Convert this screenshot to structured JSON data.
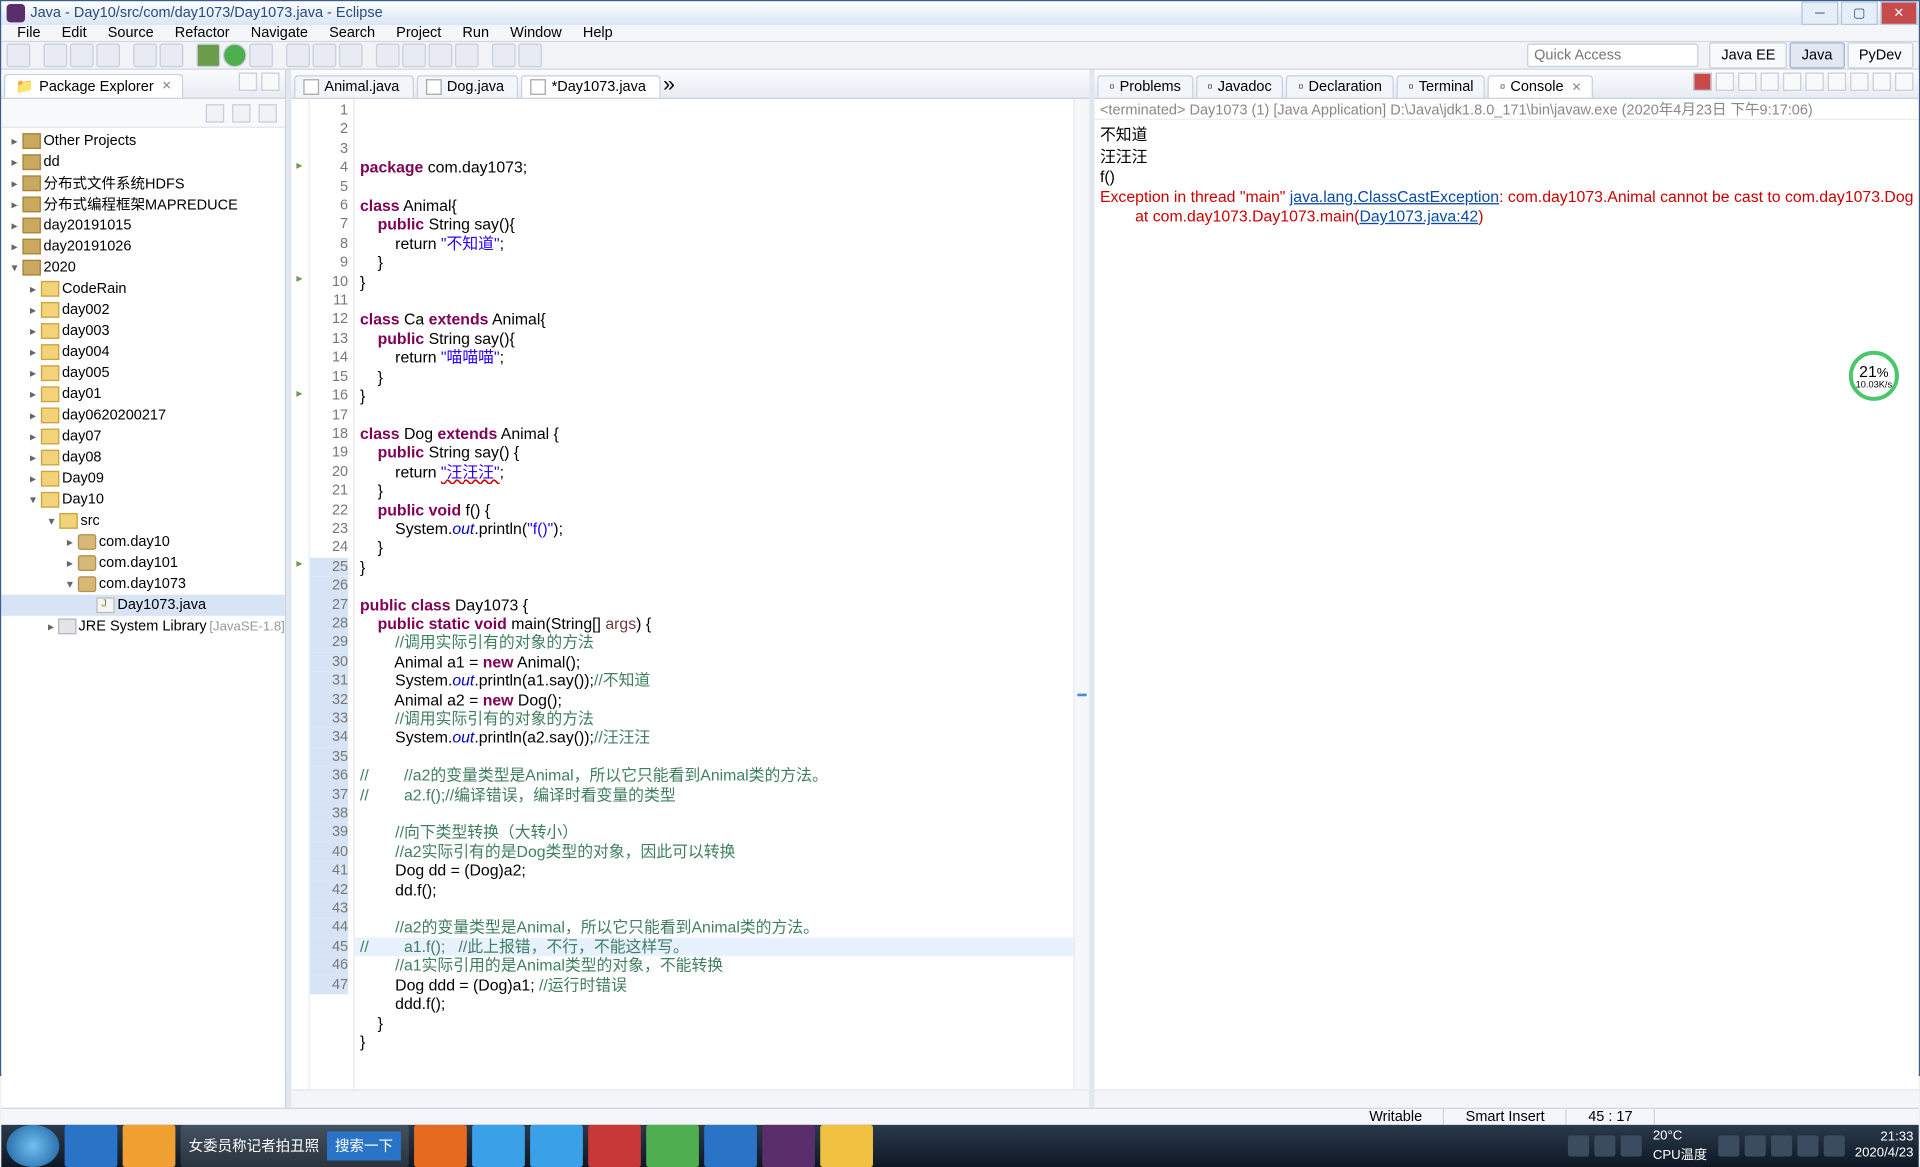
{
  "title": "Java - Day10/src/com/day1073/Day1073.java - Eclipse",
  "menus": [
    "File",
    "Edit",
    "Source",
    "Refactor",
    "Navigate",
    "Search",
    "Project",
    "Run",
    "Window",
    "Help"
  ],
  "quick_access": "Quick Access",
  "perspectives": [
    {
      "label": "Java EE"
    },
    {
      "label": "Java",
      "active": true
    },
    {
      "label": "PyDev"
    }
  ],
  "package_explorer": {
    "title": "Package Explorer",
    "items": [
      {
        "i": 0,
        "tw": "▸",
        "k": "proj",
        "label": "Other Projects"
      },
      {
        "i": 0,
        "tw": "▸",
        "k": "proj",
        "label": "dd"
      },
      {
        "i": 0,
        "tw": "▸",
        "k": "proj",
        "label": "分布式文件系统HDFS"
      },
      {
        "i": 0,
        "tw": "▸",
        "k": "proj",
        "label": "分布式编程框架MAPREDUCE"
      },
      {
        "i": 0,
        "tw": "▸",
        "k": "proj",
        "label": "day20191015"
      },
      {
        "i": 0,
        "tw": "▸",
        "k": "proj",
        "label": "day20191026"
      },
      {
        "i": 0,
        "tw": "▾",
        "k": "proj",
        "label": "2020"
      },
      {
        "i": 1,
        "tw": "▸",
        "k": "fold",
        "label": "CodeRain"
      },
      {
        "i": 1,
        "tw": "▸",
        "k": "fold",
        "label": "day002"
      },
      {
        "i": 1,
        "tw": "▸",
        "k": "fold",
        "label": "day003"
      },
      {
        "i": 1,
        "tw": "▸",
        "k": "fold",
        "label": "day004"
      },
      {
        "i": 1,
        "tw": "▸",
        "k": "fold",
        "label": "day005"
      },
      {
        "i": 1,
        "tw": "▸",
        "k": "fold",
        "label": "day01"
      },
      {
        "i": 1,
        "tw": "▸",
        "k": "fold",
        "label": "day0620200217"
      },
      {
        "i": 1,
        "tw": "▸",
        "k": "fold",
        "label": "day07"
      },
      {
        "i": 1,
        "tw": "▸",
        "k": "fold",
        "label": "day08"
      },
      {
        "i": 1,
        "tw": "▸",
        "k": "fold",
        "label": "Day09"
      },
      {
        "i": 1,
        "tw": "▾",
        "k": "fold",
        "label": "Day10"
      },
      {
        "i": 2,
        "tw": "▾",
        "k": "fold",
        "label": "src"
      },
      {
        "i": 3,
        "tw": "▸",
        "k": "pkg",
        "label": "com.day10"
      },
      {
        "i": 3,
        "tw": "▸",
        "k": "pkg",
        "label": "com.day101"
      },
      {
        "i": 3,
        "tw": "▾",
        "k": "pkg",
        "label": "com.day1073"
      },
      {
        "i": 4,
        "tw": " ",
        "k": "jfile",
        "label": "Day1073.java",
        "sel": true
      },
      {
        "i": 2,
        "tw": "▸",
        "k": "lib",
        "label": "JRE System Library",
        "ver": "[JavaSE-1.8]"
      }
    ]
  },
  "editor_tabs": [
    {
      "label": "Animal.java"
    },
    {
      "label": "Dog.java"
    },
    {
      "label": "*Day1073.java",
      "active": true
    }
  ],
  "bottom_tabs": [
    {
      "label": "Problems"
    },
    {
      "label": "Javadoc"
    },
    {
      "label": "Declaration"
    },
    {
      "label": "Terminal"
    },
    {
      "label": "Console",
      "active": true
    }
  ],
  "console_info": "<terminated> Day1073 (1) [Java Application] D:\\Java\\jdk1.8.0_171\\bin\\javaw.exe (2020年4月23日 下午9:17:06)",
  "console_lines": {
    "l1": "不知道",
    "l2": "汪汪汪",
    "l3": "f()",
    "err1_a": "Exception in thread \"main\" ",
    "err1_b": "java.lang.ClassCastException",
    "err1_c": ": com.day1073.Animal cannot be cast to com.day1073.Dog",
    "err2_a": "        at com.day1073.Day1073.main(",
    "err2_b": "Day1073.java:42",
    "err2_c": ")"
  },
  "status": {
    "writable": "Writable",
    "insert": "Smart Insert",
    "pos": "45 : 17"
  },
  "taskbar": {
    "search_label": "女委员称记者拍丑照",
    "search_btn": "搜索一下",
    "temp": "20°C",
    "cpu": "CPU温度",
    "time": "21:33",
    "date": "2020/4/23"
  },
  "speed": {
    "val": "21",
    "unit": "%",
    "rate": "10.03K/s"
  },
  "code": {
    "lines": 47,
    "current": 45,
    "sel_start": 25,
    "sel_end": 47,
    "t01a": "package",
    "t01b": " com.day1073;",
    "t03a": "class",
    "t03b": " Animal{",
    "t04a": "    public",
    "t04b": " String say(){",
    "t05a": "        return ",
    "t05b": "\"不知道\"",
    "t05c": ";",
    "t06": "    }",
    "t07": "}",
    "t09a": "class",
    "t09b": " Ca ",
    "t09c": "extends",
    "t09d": " Animal{",
    "t10a": "    public",
    "t10b": " String say(){",
    "t11a": "        return ",
    "t11b": "\"喵喵喵\"",
    "t11c": ";",
    "t12": "    }",
    "t13": "}",
    "t15a": "class",
    "t15b": " Dog ",
    "t15c": "extends",
    "t15d": " Animal {",
    "t16a": "    public",
    "t16b": " String say() {",
    "t17a": "        return ",
    "t17b": "\"汪汪汪\"",
    "t17c": ";",
    "t18": "    }",
    "t19a": "    public void",
    "t19b": " f() {",
    "t20a": "        System.",
    "t20b": "out",
    "t20c": ".println(",
    "t20d": "\"f()\"",
    "t20e": ");",
    "t21": "    }",
    "t22": "}",
    "t24a": "public class",
    "t24b": " Day1073 {",
    "t25a": "    public static void",
    "t25b": " main(String[] ",
    "t25c": "args",
    "t25d": ") {",
    "t26": "        //调用实际引有的对象的方法",
    "t27a": "        Animal a1 = ",
    "t27b": "new",
    "t27c": " Animal();",
    "t28a": "        System.",
    "t28b": "out",
    "t28c": ".println(a1.say());",
    "t28d": "//不知道",
    "t29a": "        Animal a2 = ",
    "t29b": "new",
    "t29c": " Dog();",
    "t30": "        //调用实际引有的对象的方法",
    "t31a": "        System.",
    "t31b": "out",
    "t31c": ".println(a2.say());",
    "t31d": "//汪汪汪",
    "t33": "//        //a2的变量类型是Animal，所以它只能看到Animal类的方法。",
    "t34": "//        a2.f();//编译错误，编译时看变量的类型",
    "t36": "        //向下类型转换（大转小）",
    "t37": "        //a2实际引有的是Dog类型的对象，因此可以转换",
    "t38": "        Dog dd = (Dog)a2;",
    "t39": "        dd.f();",
    "t41": "        //a2的变量类型是Animal，所以它只能看到Animal类的方法。",
    "t42a": "//        a1.f();   ",
    "t42b": "//此上报错，不行，不能这样写。",
    "t43": "        //a1实际引用的是Animal类型的对象，不能转换",
    "t44a": "        Dog ddd = (Dog)a1; ",
    "t44b": "//运行时错误",
    "t45": "        ddd.f();",
    "t46": "    }",
    "t47": "}"
  }
}
